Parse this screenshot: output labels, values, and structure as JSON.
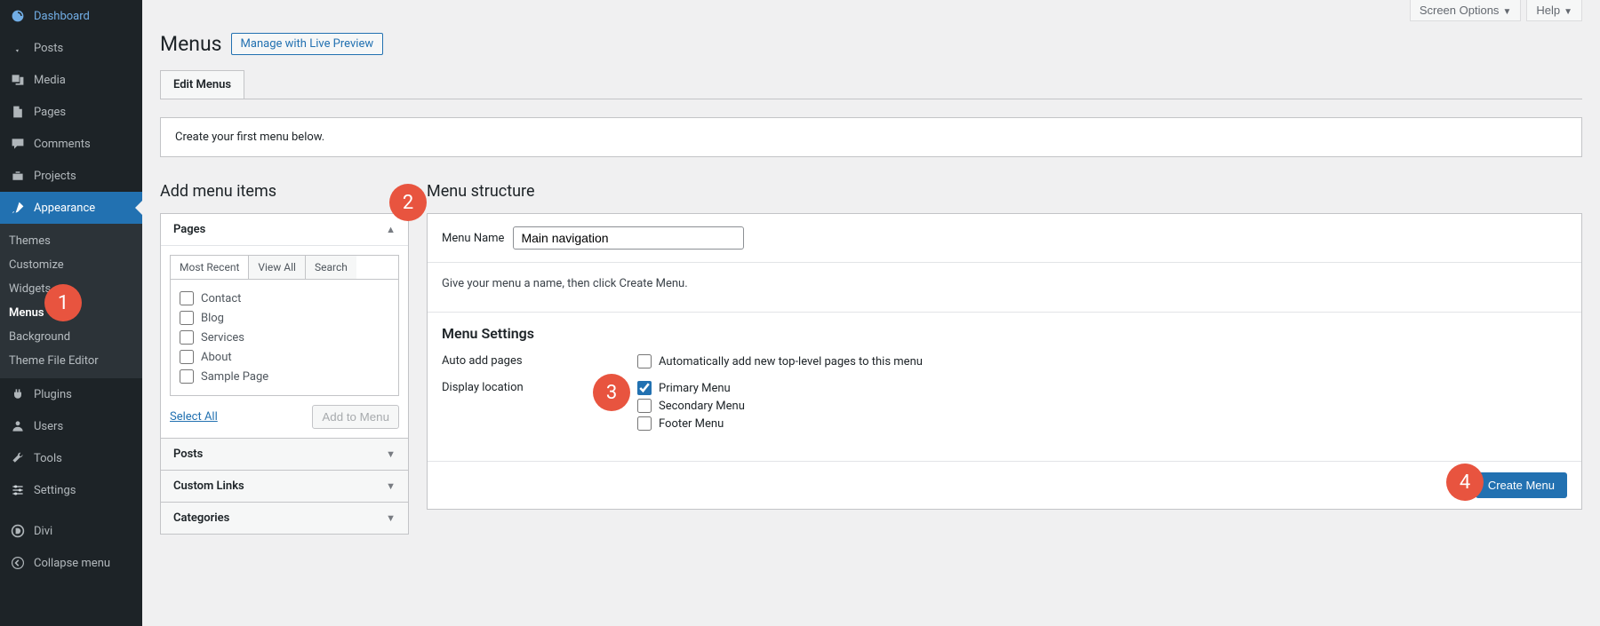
{
  "topbar": {
    "screen_options": "Screen Options",
    "help": "Help"
  },
  "page": {
    "title": "Menus",
    "manage_preview": "Manage with Live Preview"
  },
  "tabs": {
    "edit_menus": "Edit Menus"
  },
  "intro": {
    "text": "Create your first menu below."
  },
  "add_items": {
    "title": "Add menu items",
    "pages": {
      "label": "Pages",
      "tabs": {
        "recent": "Most Recent",
        "view_all": "View All",
        "search": "Search"
      },
      "items": [
        "Contact",
        "Blog",
        "Services",
        "About",
        "Sample Page"
      ],
      "select_all": "Select All",
      "add_to_menu": "Add to Menu"
    },
    "posts_label": "Posts",
    "custom_links_label": "Custom Links",
    "categories_label": "Categories"
  },
  "structure": {
    "title": "Menu structure",
    "name_label": "Menu Name",
    "name_value": "Main navigation",
    "hint": "Give your menu a name, then click Create Menu.",
    "settings_title": "Menu Settings",
    "auto_add_label": "Auto add pages",
    "auto_add_option": "Automatically add new top-level pages to this menu",
    "display_label": "Display location",
    "locations": {
      "primary": "Primary Menu",
      "secondary": "Secondary Menu",
      "footer": "Footer Menu"
    },
    "create_btn": "Create Menu"
  },
  "sidebar": {
    "dashboard": "Dashboard",
    "posts": "Posts",
    "media": "Media",
    "pages": "Pages",
    "comments": "Comments",
    "projects": "Projects",
    "appearance": "Appearance",
    "themes": "Themes",
    "customize": "Customize",
    "widgets": "Widgets",
    "menus": "Menus",
    "background": "Background",
    "theme_editor": "Theme File Editor",
    "plugins": "Plugins",
    "users": "Users",
    "tools": "Tools",
    "settings": "Settings",
    "divi": "Divi",
    "collapse": "Collapse menu"
  },
  "badges": {
    "one": "1",
    "two": "2",
    "three": "3",
    "four": "4"
  }
}
